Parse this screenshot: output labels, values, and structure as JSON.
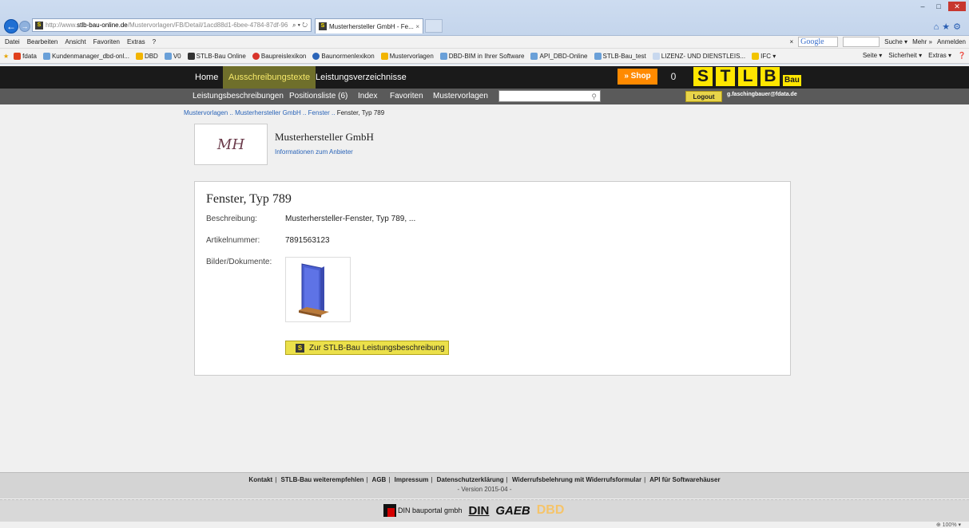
{
  "browser": {
    "url_prefix": "http://www.",
    "url_host": "stlb-bau-online.de",
    "url_path": "/Mustervorlagen/FB/Detail/1acd88d1-6bee-4784-87df-96",
    "address_controls": "⌕ ▾ ↻",
    "tab_title": "Musterhersteller GmbH - Fe...",
    "tab_close": "×",
    "menu": [
      "Datei",
      "Bearbeiten",
      "Ansicht",
      "Favoriten",
      "Extras",
      "?"
    ],
    "search_close": "×",
    "search_engine": "Google",
    "menu_right": [
      "Suche ▾",
      "Mehr »",
      "Anmelden"
    ],
    "favorites": [
      {
        "label": "fdata",
        "color": "#e0401c"
      },
      {
        "label": "Kundenmanager_dbd-onl...",
        "color": "#6aa0d8"
      },
      {
        "label": "DBD",
        "color": "#f2b400"
      },
      {
        "label": "V0",
        "color": "#6aa0d8"
      },
      {
        "label": "STLB-Bau Online",
        "color": "#333333"
      },
      {
        "label": "Baupreislexikon",
        "color": "#d8342a"
      },
      {
        "label": "Baunormenlexikon",
        "color": "#2a64b8"
      },
      {
        "label": "Mustervorlagen",
        "color": "#f2b400"
      },
      {
        "label": "DBD-BIM in Ihrer Software",
        "color": "#6aa0d8"
      },
      {
        "label": "API_DBD-Online",
        "color": "#6aa0d8"
      },
      {
        "label": "STLB-Bau_test",
        "color": "#6aa0d8"
      },
      {
        "label": "LIZENZ- UND DIENSTLEIS...",
        "color": "#c8d8ee"
      },
      {
        "label": "IFC ▾",
        "color": "#f2c400"
      }
    ],
    "tools": [
      "Seite ▾",
      "Sicherheit ▾",
      "Extras ▾"
    ],
    "zoom": "⊕ 100% ▾"
  },
  "nav": {
    "home": "Home",
    "ausschreibung": "Ausschreibungstexte",
    "lv": "Leistungsverzeichnisse",
    "shop": "» Shop",
    "cart_count": "0",
    "logo_letters": [
      "S",
      "T",
      "L",
      "B"
    ],
    "logo_suffix": "Bau",
    "sub": [
      "Leistungsbeschreibungen",
      "Positionsliste (6)",
      "Index",
      "Favoriten",
      "Mustervorlagen"
    ],
    "logout": "Logout",
    "user": "g.faschingbauer@fdata.de"
  },
  "breadcrumb": {
    "items": [
      "Mustervorlagen",
      "Musterhersteller GmbH",
      "Fenster"
    ],
    "current": "Fenster, Typ 789",
    "separator": ".."
  },
  "vendor": {
    "logo_text": "MH",
    "name": "Musterhersteller GmbH",
    "info_link": "Informationen zum Anbieter"
  },
  "product": {
    "title": "Fenster, Typ 789",
    "desc_label": "Beschreibung:",
    "desc_value": "Musterhersteller-Fenster, Typ 789, ...",
    "art_label": "Artikelnummer:",
    "art_value": "7891563123",
    "docs_label": "Bilder/Dokumente:",
    "cta_icon": "S",
    "cta_label": "Zur STLB-Bau Leistungsbeschreibung"
  },
  "footer": {
    "links": [
      "Kontakt",
      "STLB-Bau weiterempfehlen",
      "AGB",
      "Impressum",
      "Datenschutzerklärung",
      "Widerrufsbelehrung mit Widerrufsformular",
      "API für Softwarehäuser"
    ],
    "version": "- Version 2015-04 -",
    "partners": {
      "din_bauportal": "DIN bauportal gmbh",
      "din": "DIN",
      "gaeb": "GAEB",
      "dbd": "DBD"
    }
  }
}
